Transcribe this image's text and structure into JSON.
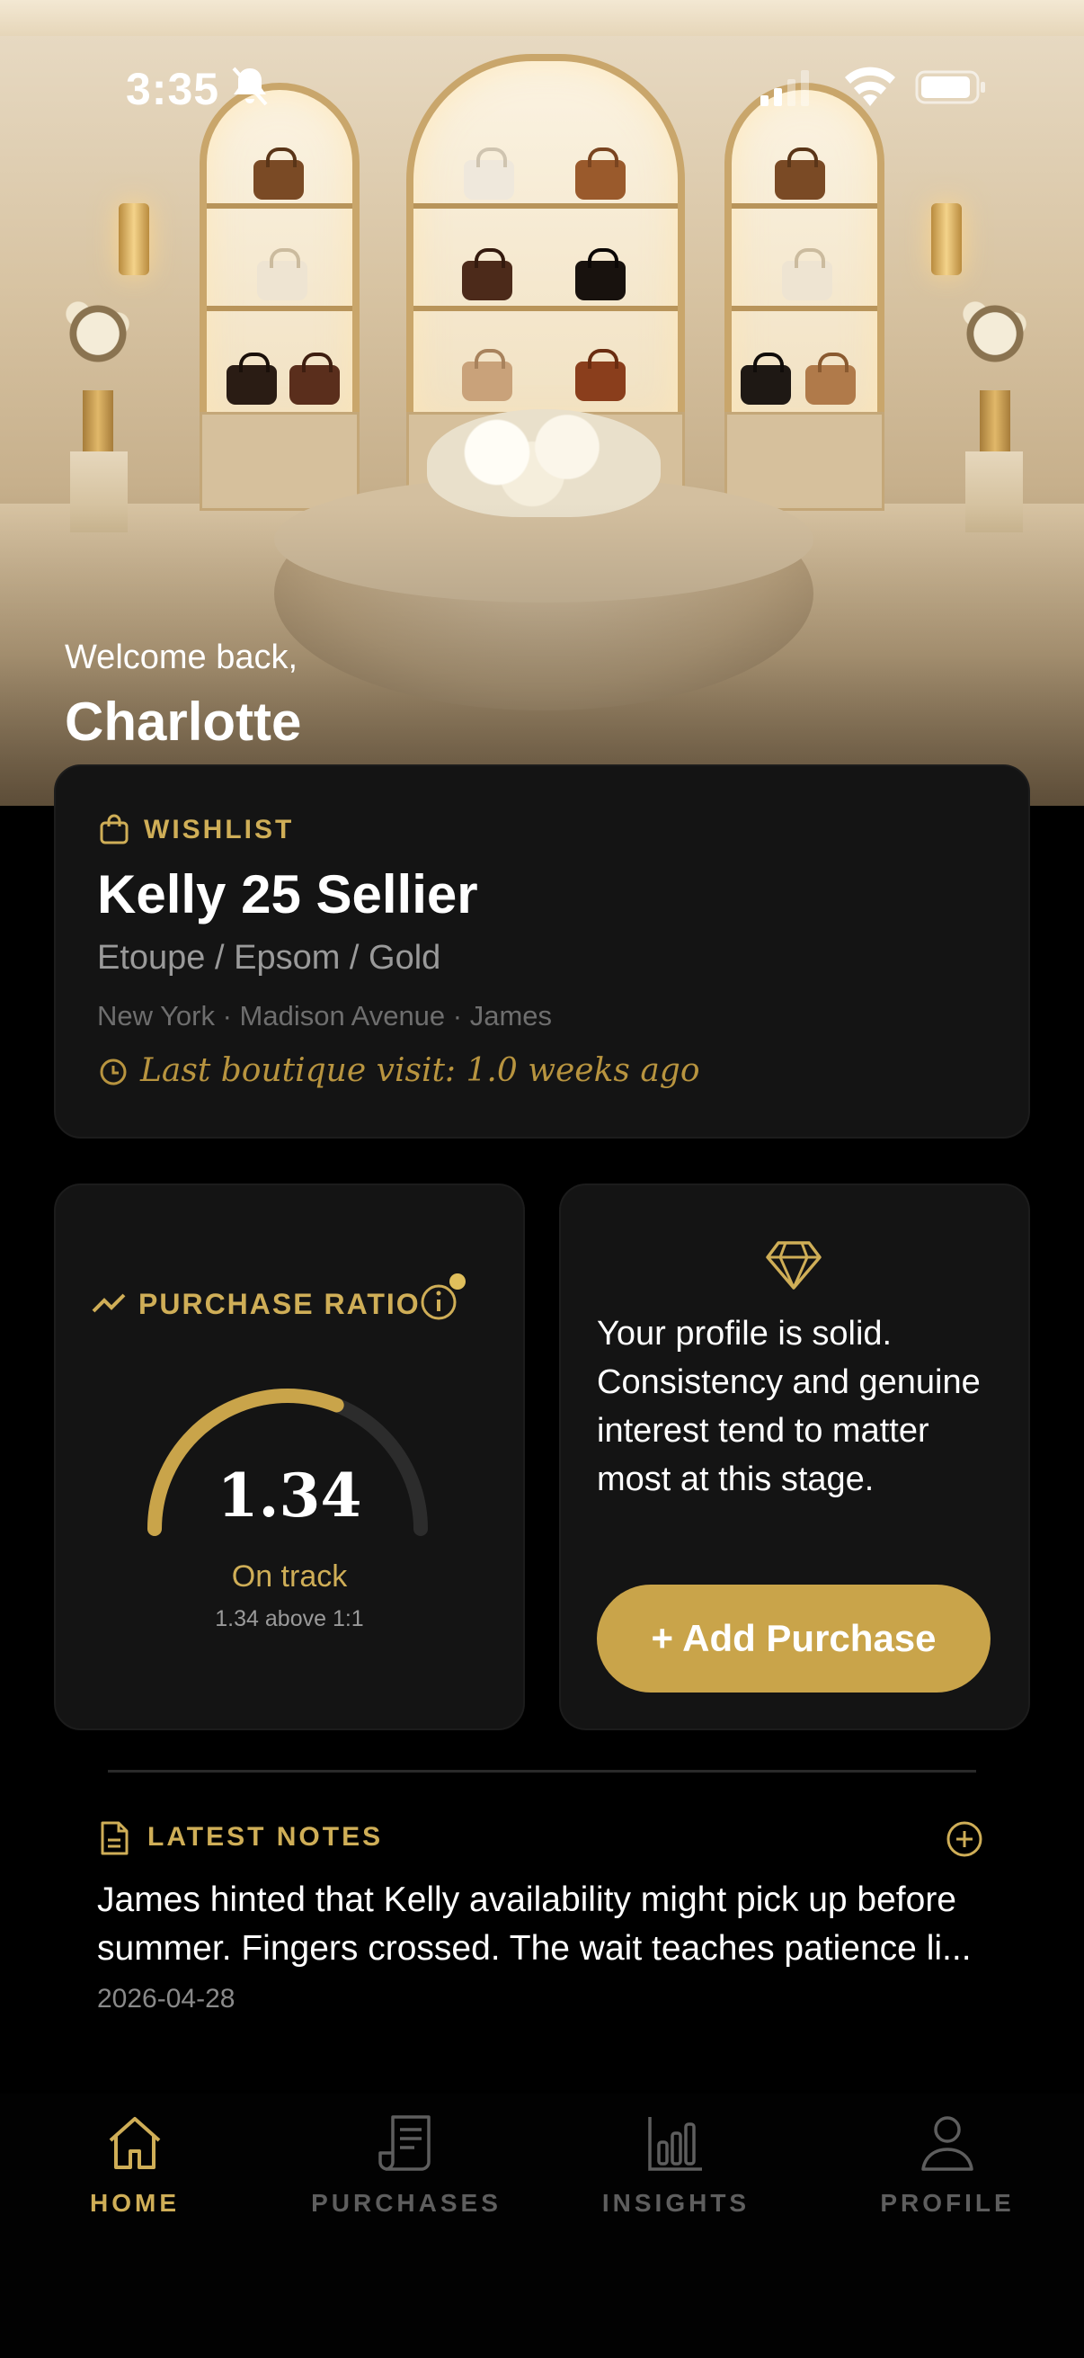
{
  "status_bar": {
    "time": "3:35"
  },
  "hero": {
    "welcome": "Welcome back,",
    "name": "Charlotte"
  },
  "wishlist": {
    "label": "WISHLIST",
    "title": "Kelly 25 Sellier",
    "subtitle": "Etoupe / Epsom / Gold",
    "location": "New York · Madison Avenue · James",
    "last_visit": "Last boutique visit: 1.0 weeks ago"
  },
  "purchase_ratio": {
    "label": "PURCHASE RATIO",
    "value": "1.34",
    "status": "On track",
    "note": "1.34 above 1:1",
    "gauge_fill_fraction": 0.62
  },
  "tip": {
    "text": "Your profile is solid. Consistency and genuine interest tend to matter most at this stage.",
    "button_label": "+ Add Purchase"
  },
  "notes": {
    "label": "LATEST NOTES",
    "text": "James hinted that Kelly availability might pick up before summer. Fingers crossed. The wait teaches patience li...",
    "date": "2026-04-28"
  },
  "tabs": [
    {
      "label": "HOME",
      "icon": "home-icon",
      "active": true
    },
    {
      "label": "PURCHASES",
      "icon": "receipt-icon",
      "active": false
    },
    {
      "label": "INSIGHTS",
      "icon": "bar-chart-icon",
      "active": false
    },
    {
      "label": "PROFILE",
      "icon": "person-icon",
      "active": false
    }
  ],
  "colors": {
    "accent": "#cfae57",
    "button": "#c9a44a",
    "card": "#141414",
    "background": "#000000",
    "inactive": "#5e5e5e"
  }
}
